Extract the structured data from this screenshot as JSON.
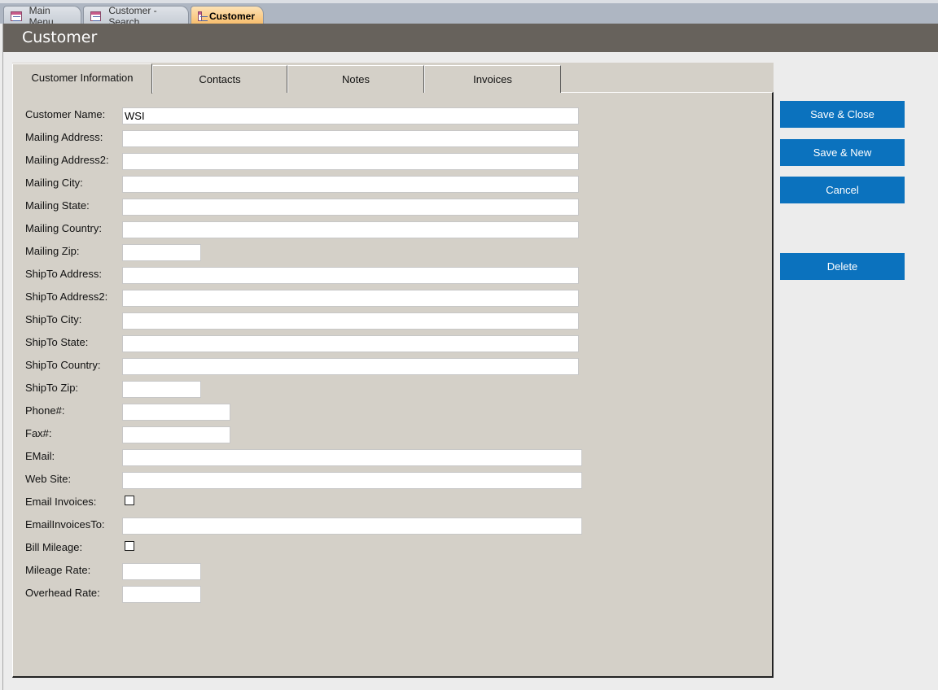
{
  "document_tabs": [
    {
      "label": "Main Menu",
      "icon": "form-icon",
      "active": false
    },
    {
      "label": "Customer - Search",
      "icon": "form-icon",
      "active": false
    },
    {
      "label": "Customer",
      "icon": "form-icon",
      "active": true
    }
  ],
  "header": {
    "title": "Customer"
  },
  "form_tabs": [
    {
      "label": "Customer Information",
      "active": true
    },
    {
      "label": "Contacts",
      "active": false
    },
    {
      "label": "Notes",
      "active": false
    },
    {
      "label": "Invoices",
      "active": false
    }
  ],
  "fields": {
    "customer_name": {
      "label": "Customer Name:",
      "value": "WSI"
    },
    "mailing_address": {
      "label": "Mailing Address:",
      "value": ""
    },
    "mailing_address2": {
      "label": "Mailing Address2:",
      "value": ""
    },
    "mailing_city": {
      "label": "Mailing City:",
      "value": ""
    },
    "mailing_state": {
      "label": "Mailing State:",
      "value": ""
    },
    "mailing_country": {
      "label": "Mailing Country:",
      "value": ""
    },
    "mailing_zip": {
      "label": "Mailing Zip:",
      "value": ""
    },
    "shipto_address": {
      "label": "ShipTo Address:",
      "value": ""
    },
    "shipto_address2": {
      "label": "ShipTo Address2:",
      "value": ""
    },
    "shipto_city": {
      "label": "ShipTo City:",
      "value": ""
    },
    "shipto_state": {
      "label": "ShipTo State:",
      "value": ""
    },
    "shipto_country": {
      "label": "ShipTo Country:",
      "value": ""
    },
    "shipto_zip": {
      "label": "ShipTo Zip:",
      "value": ""
    },
    "phone": {
      "label": "Phone#:",
      "value": ""
    },
    "fax": {
      "label": "Fax#:",
      "value": ""
    },
    "email": {
      "label": "EMail:",
      "value": ""
    },
    "web_site": {
      "label": "Web Site:",
      "value": ""
    },
    "email_invoices": {
      "label": "Email Invoices:",
      "checked": false
    },
    "email_invoices_to": {
      "label": "EmailInvoicesTo:",
      "value": ""
    },
    "bill_mileage": {
      "label": "Bill Mileage:",
      "checked": false
    },
    "mileage_rate": {
      "label": "Mileage Rate:",
      "value": ""
    },
    "overhead_rate": {
      "label": "Overhead Rate:",
      "value": ""
    }
  },
  "buttons": {
    "save_close": "Save & Close",
    "save_new": "Save & New",
    "cancel": "Cancel",
    "delete": "Delete"
  },
  "colors": {
    "header_bg": "#67625c",
    "button_bg": "#0b72be",
    "panel_bg": "#d4d0c8",
    "active_doc_tab": "#f7b964"
  }
}
